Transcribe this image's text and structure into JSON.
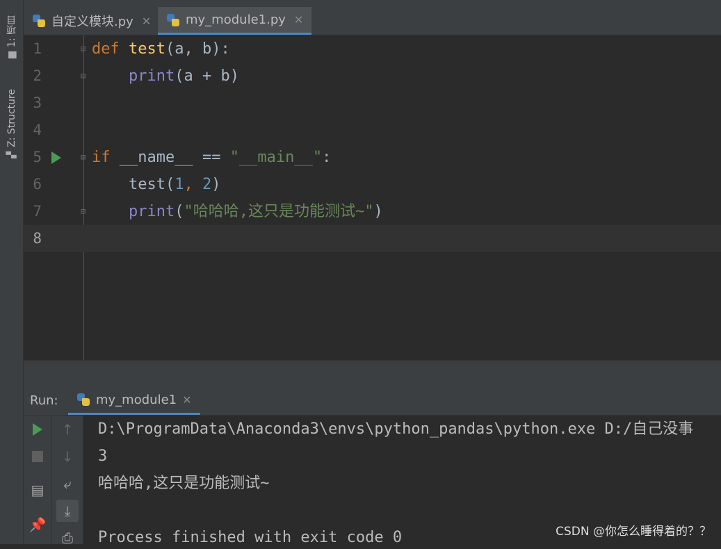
{
  "side_tabs": {
    "project_label": "1: 项目",
    "structure_label": "Z: Structure"
  },
  "tabs": [
    {
      "label": "自定义模块.py"
    },
    {
      "label": "my_module1.py"
    }
  ],
  "editor": {
    "line_numbers": [
      "1",
      "2",
      "3",
      "4",
      "5",
      "6",
      "7",
      "8"
    ],
    "code": {
      "l1_kw": "def",
      "l1_fn": "test",
      "l1_rest": "(a, b):",
      "l2_indent": "    ",
      "l2_bi": "print",
      "l2_rest": "(a + b)",
      "l5_kw": "if",
      "l5_mid": " __name__ == ",
      "l5_str": "\"__main__\"",
      "l5_end": ":",
      "l6_call": "    test(",
      "l6_n1": "1",
      "l6_sep": ", ",
      "l6_n2": "2",
      "l6_close": ")",
      "l7_indent": "    ",
      "l7_bi": "print",
      "l7_open": "(",
      "l7_str": "\"哈哈哈,这只是功能测试~\"",
      "l7_close": ")"
    }
  },
  "run_panel": {
    "label": "Run:",
    "tab_label": "my_module1"
  },
  "console": {
    "lines": [
      "D:\\ProgramData\\Anaconda3\\envs\\python_pandas\\python.exe D:/自己没事",
      "3",
      "哈哈哈,这只是功能测试~",
      "",
      "Process finished with exit code 0"
    ]
  },
  "watermark": "CSDN @你怎么睡得着的？？",
  "colors": {
    "keyword": "#cc7832",
    "function": "#ffc66d",
    "builtin": "#8888c6",
    "string": "#6a8759",
    "number": "#6897bb",
    "run_green": "#499c54",
    "tab_underline": "#4a88c7"
  }
}
